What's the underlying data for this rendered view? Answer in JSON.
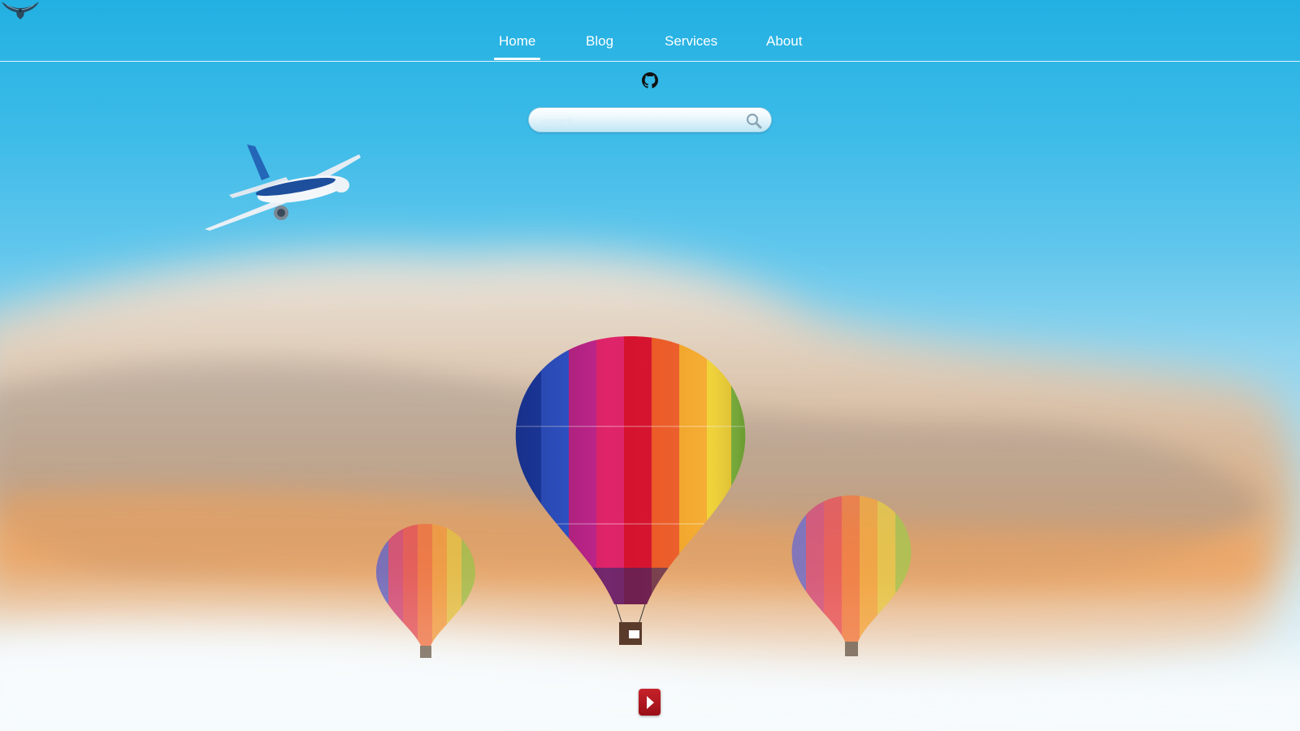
{
  "header": {
    "logo_icon": "eagle-logo-icon"
  },
  "nav": {
    "items": [
      {
        "label": "Home",
        "active": true
      },
      {
        "label": "Blog",
        "active": false
      },
      {
        "label": "Services",
        "active": false
      },
      {
        "label": "About",
        "active": false
      }
    ]
  },
  "social": {
    "github_icon": "github-icon"
  },
  "search": {
    "placeholder": "search",
    "value": "",
    "button_icon": "search-icon"
  },
  "hero": {
    "images": [
      "airplane",
      "hot-air-balloon-large",
      "hot-air-balloon-left",
      "hot-air-balloon-right",
      "clouds"
    ],
    "play_icon": "play-icon"
  },
  "colors": {
    "sky_top": "#22b0e2",
    "sky_bottom": "#f4f9fb",
    "nav_text": "#ffffff",
    "play_button": "#b5161e"
  }
}
